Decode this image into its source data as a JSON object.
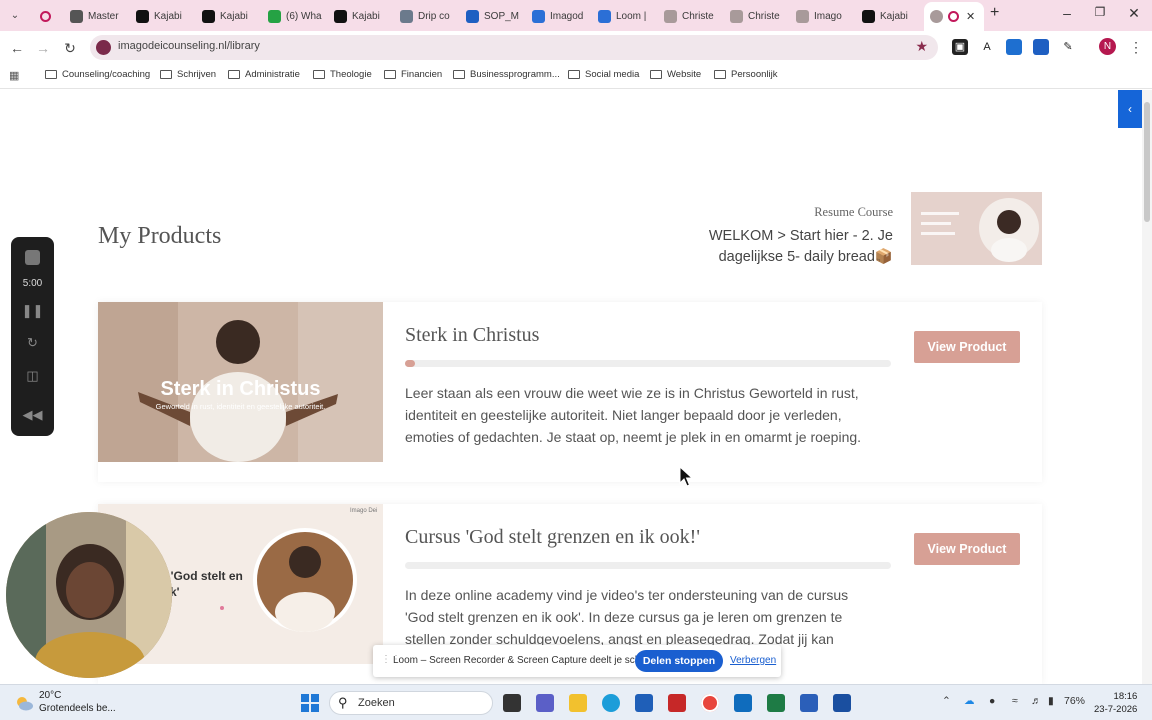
{
  "browser": {
    "tabs": [
      {
        "label": "Master",
        "favicon": "chatgpt-icon",
        "color": "#555555"
      },
      {
        "label": "Kajabi",
        "favicon": "kajabi-icon",
        "color": "#111111"
      },
      {
        "label": "Kajabi",
        "favicon": "kajabi-icon",
        "color": "#111111"
      },
      {
        "label": "(6) Wha",
        "favicon": "whatsapp-icon",
        "color": "#25a244"
      },
      {
        "label": "Kajabi",
        "favicon": "kajabi-icon",
        "color": "#111111"
      },
      {
        "label": "Drip co",
        "favicon": "drip-icon",
        "color": "#6b7a8c"
      },
      {
        "label": "SOP_M",
        "favicon": "word-icon",
        "color": "#1e5fc2"
      },
      {
        "label": "Imagod",
        "favicon": "imagodei-icon",
        "color": "#2b6fd6"
      },
      {
        "label": "Loom |",
        "favicon": "loom-icon",
        "color": "#2b6fd6"
      },
      {
        "label": "Christe",
        "favicon": "christe-icon",
        "color": "#a89a9a"
      },
      {
        "label": "Christe",
        "favicon": "christe-icon",
        "color": "#a89a9a"
      },
      {
        "label": "Imago",
        "favicon": "imago-icon",
        "color": "#a89a9a"
      },
      {
        "label": "Kajabi",
        "favicon": "kajabi-icon",
        "color": "#111111"
      }
    ],
    "url": "imagodeicounseling.nl/library",
    "bookmarks": [
      "Counseling/coaching",
      "Schrijven",
      "Administratie",
      "Theologie",
      "Financien",
      "Businessprogramm...",
      "Social media",
      "Website",
      "Persoonlijk"
    ],
    "profile_initial": "N"
  },
  "page": {
    "heading": "My Products",
    "resume": {
      "label": "Resume Course",
      "title": "WELKOM > Start hier - 2. Je dagelijkse 5- daily bread📦"
    },
    "products": [
      {
        "title": "Sterk in Christus",
        "image_title": "Sterk in Christus",
        "image_subtitle": "Geworteld in rust, identiteit en geestelijke autoriteit.",
        "progress": 0.02,
        "description": "Leer staan als een vrouw die weet wie ze is in Christus Geworteld in rust, identiteit en geestelijke autoriteit. Niet langer bepaald door je verleden, emoties of gedachten. Je staat op, neemt je plek in en omarmt je roeping.",
        "button": "View Product"
      },
      {
        "title": "Cursus 'God stelt grenzen en ik ook!'",
        "image_title": "rsus 'God stelt en ik ook'",
        "image_brand": "Imago Dei",
        "progress": 0.0,
        "description": "In deze online academy vind je video's ter ondersteuning van de cursus 'God stelt grenzen en ik ook'. In deze cursus ga je leren om grenzen te stellen zonder schuldgevoelens, angst en pleasegedrag. Zodat jij kan wandelen in",
        "button": "View Product"
      }
    ],
    "accent_color": "#d7a095"
  },
  "loom": {
    "timer": "5:00",
    "share_message": "Loom – Screen Recorder & Screen Capture deelt je scherm.",
    "stop_label": "Delen stoppen",
    "hide_label": "Verbergen"
  },
  "taskbar": {
    "temperature": "20°C",
    "weather": "Grotendeels be...",
    "search_placeholder": "Zoeken",
    "battery": "76%",
    "time": "18:16",
    "date": "23-7-2026"
  }
}
